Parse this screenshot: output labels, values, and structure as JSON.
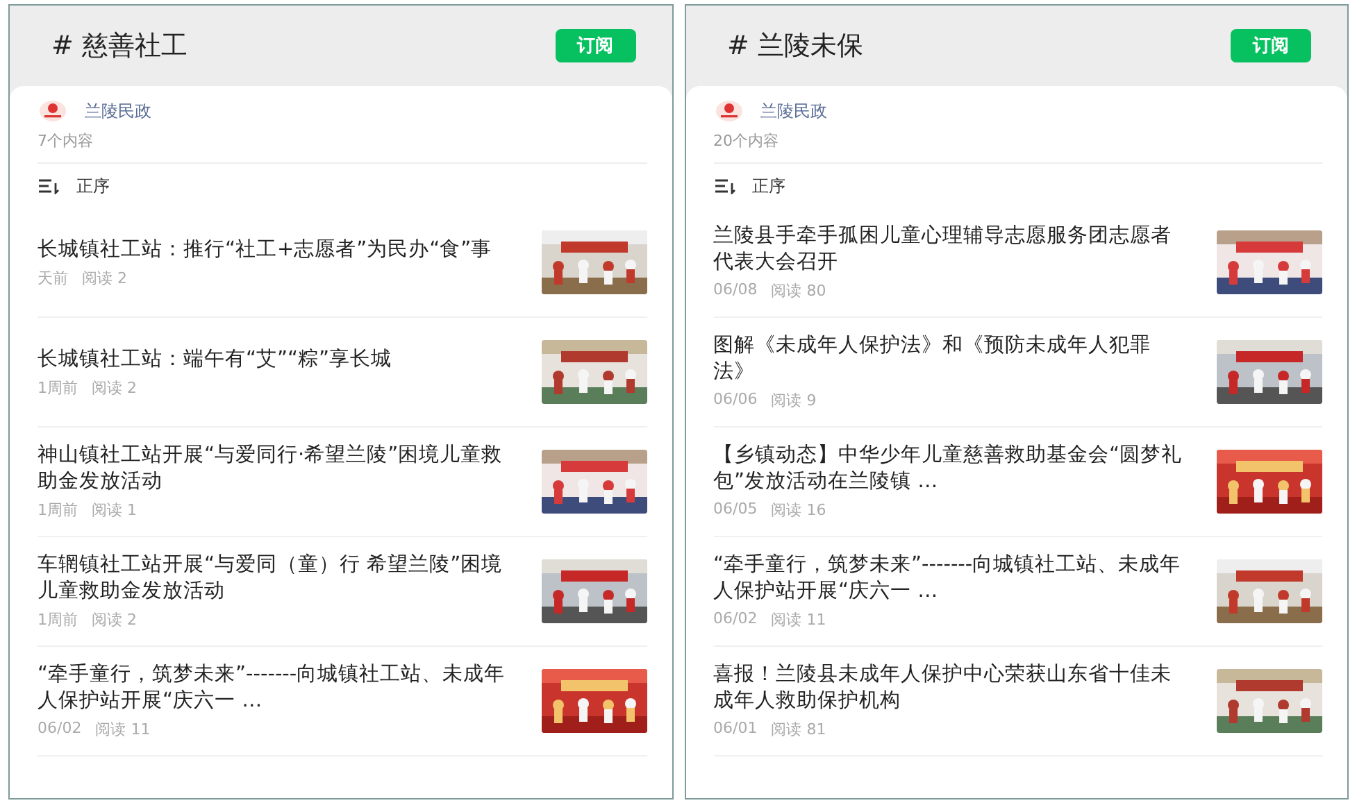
{
  "panels": [
    {
      "title": "# 慈善社工",
      "subscribe": "订阅",
      "source": "兰陵民政",
      "count": "7个内容",
      "sort": "正序",
      "articles": [
        {
          "title": "长城镇社工站：推行“社工+志愿者”为民办“食”事",
          "time": "天前",
          "reads": "阅读 2",
          "kind": "picture"
        },
        {
          "title": "长城镇社工站：端午有“艾”“粽”享长城",
          "time": "1周前",
          "reads": "阅读 2",
          "kind": "picture"
        },
        {
          "title": "神山镇社工站开展“与爱同行·希望兰陵”困境儿童救助金发放活动",
          "time": "1周前",
          "reads": "阅读 1",
          "kind": "picture"
        },
        {
          "title": "车辋镇社工站开展“与爱同（童）行 希望兰陵”困境儿童救助金发放活动",
          "time": "1周前",
          "reads": "阅读 2",
          "kind": "picture"
        },
        {
          "title": "“牵手童行，筑梦未来”-------向城镇社工站、未成年人保护站开展“庆六一 …",
          "time": "06/02",
          "reads": "阅读 11",
          "kind": "picture"
        }
      ]
    },
    {
      "title": "# 兰陵未保",
      "subscribe": "订阅",
      "source": "兰陵民政",
      "count": "20个内容",
      "sort": "正序",
      "articles": [
        {
          "title": "兰陵县手牵手孤困儿童心理辅导志愿服务团志愿者代表大会召开",
          "time": "06/08",
          "reads": "阅读 80",
          "kind": "picture"
        },
        {
          "title": "图解《未成年人保护法》和《预防未成年人犯罪法》",
          "time": "06/06",
          "reads": "阅读 9",
          "kind": "picture"
        },
        {
          "title": "【乡镇动态】中华少年儿童慈善救助基金会“圆梦礼包”发放活动在兰陵镇 …",
          "time": "06/05",
          "reads": "阅读 16",
          "kind": "picture"
        },
        {
          "title": "“牵手童行，筑梦未来”-------向城镇社工站、未成年人保护站开展“庆六一 …",
          "time": "06/02",
          "reads": "阅读 11",
          "kind": "picture"
        },
        {
          "title": "喜报！兰陵县未成年人保护中心荣获山东省十佳未成年人救助保护机构",
          "time": "06/01",
          "reads": "阅读 81",
          "kind": "picture"
        }
      ]
    }
  ]
}
